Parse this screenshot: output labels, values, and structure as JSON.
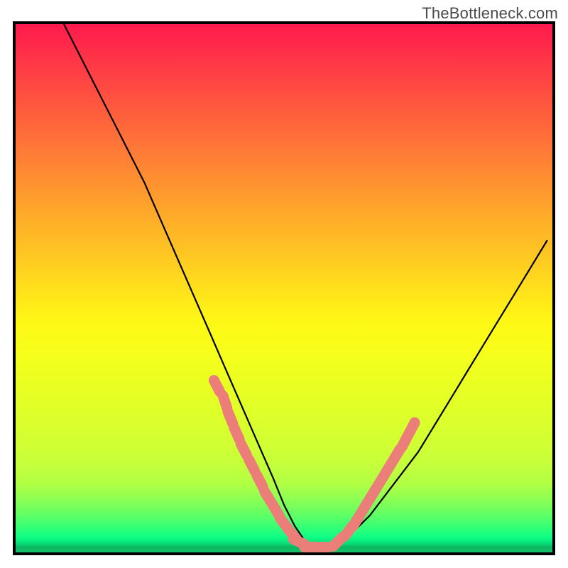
{
  "watermark": {
    "text": "TheBottleneck.com"
  },
  "chart_data": {
    "type": "line",
    "title": "",
    "xlabel": "",
    "ylabel": "",
    "xlim": [
      0,
      100
    ],
    "ylim": [
      0,
      100
    ],
    "grid": false,
    "legend": false,
    "series": [
      {
        "name": "bottleneck-curve",
        "color": "#000000",
        "x": [
          9,
          12,
          15,
          18,
          21,
          24,
          27,
          30,
          33,
          36,
          39,
          42,
          45,
          48,
          50,
          52,
          54,
          56,
          58,
          60,
          63,
          66,
          69,
          72,
          75,
          78,
          81,
          84,
          87,
          90,
          93,
          96,
          99
        ],
        "y": [
          100,
          94,
          88,
          82,
          76,
          70,
          63,
          56,
          49,
          42,
          35,
          28,
          21,
          14,
          9,
          5,
          2,
          1,
          1,
          2,
          4,
          7,
          11,
          15,
          19,
          24,
          29,
          34,
          39,
          44,
          49,
          54,
          59
        ]
      }
    ],
    "markers": [
      {
        "name": "pink-dots-left",
        "color": "#ec7e7a",
        "shape": "rounded-capsule",
        "x": [
          37.5,
          39.0,
          40.0,
          41.2,
          42.5,
          44.0,
          45.5,
          47.0,
          48.5,
          50.0,
          51.5,
          52.8,
          55.0,
          57.0
        ],
        "y": [
          31.5,
          28.5,
          25.5,
          22.5,
          19.5,
          16.5,
          13.5,
          10.5,
          8.0,
          5.5,
          3.5,
          2.0,
          1.0,
          1.0
        ]
      },
      {
        "name": "pink-dots-right",
        "color": "#ec7e7a",
        "shape": "rounded-capsule",
        "x": [
          60.0,
          62.0,
          63.5,
          65.0,
          66.5,
          68.0,
          69.5,
          71.0,
          72.5,
          73.8
        ],
        "y": [
          2.0,
          4.0,
          6.0,
          8.5,
          11.0,
          13.5,
          16.0,
          18.5,
          21.0,
          23.5
        ]
      }
    ]
  }
}
